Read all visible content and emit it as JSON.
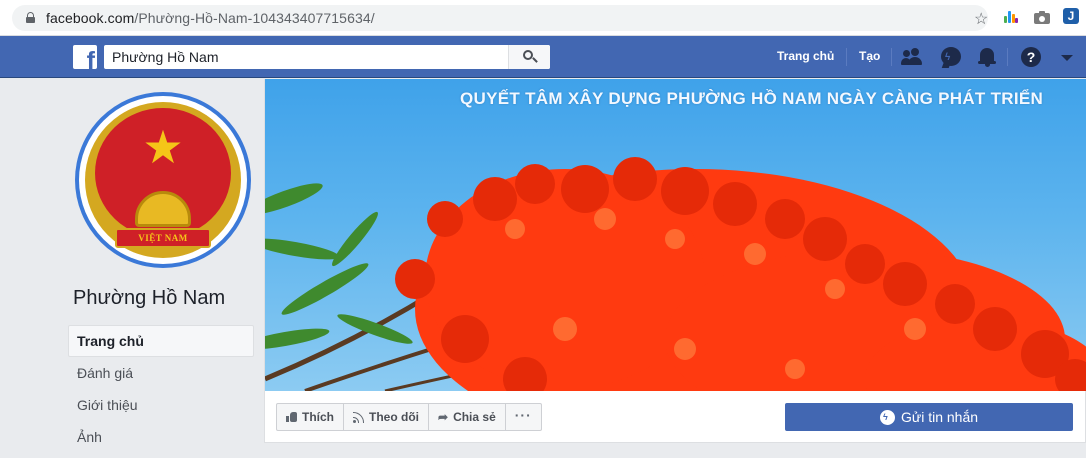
{
  "browser": {
    "url_host": "facebook.com",
    "url_path": "/Phường-Hồ-Nam-104343407715634/"
  },
  "fb_header": {
    "search_value": "Phường Hồ Nam",
    "nav": {
      "home": "Trang chủ",
      "create": "Tạo"
    },
    "icons": [
      "friend-requests-icon",
      "messenger-icon",
      "notifications-icon",
      "help-icon",
      "account-menu-icon"
    ],
    "colors": {
      "bar": "#4267b2",
      "icon_dark": "#1d2a4a"
    }
  },
  "page": {
    "name": "Phường Hồ Nam",
    "emblem_text": "VIỆT NAM"
  },
  "left_nav": [
    {
      "label": "Trang chủ",
      "active": true
    },
    {
      "label": "Đánh giá",
      "active": false
    },
    {
      "label": "Giới thiệu",
      "active": false
    },
    {
      "label": "Ảnh",
      "active": false
    }
  ],
  "cover": {
    "slogan": "QUYẾT TÂM XÂY DỰNG PHƯỜNG HỒ NAM NGÀY CÀNG PHÁT TRIỂN"
  },
  "actions": {
    "like": "Thích",
    "follow": "Theo dõi",
    "share": "Chia sẻ",
    "more": "···",
    "send_message": "Gửi tin nhắn"
  }
}
